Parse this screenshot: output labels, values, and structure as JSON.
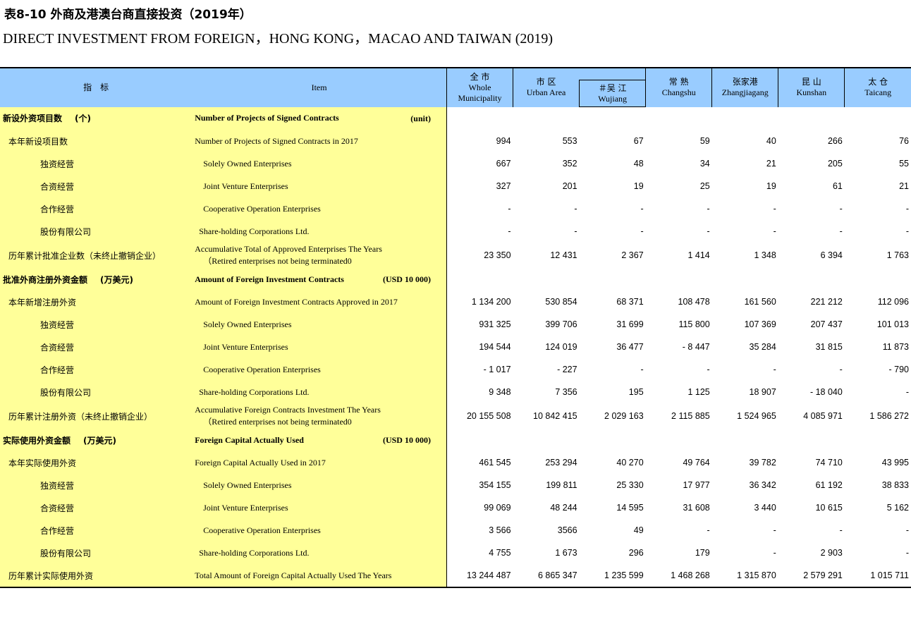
{
  "title": {
    "cn": "表8-10 外商及港澳台商直接投资（2019年）",
    "en": "DIRECT INVESTMENT FROM FOREIGN，HONG KONG，MACAO AND TAIWAN (2019)"
  },
  "header": {
    "indicator": "指　标",
    "item": "Item",
    "whole": {
      "cn": "全 市",
      "en1": "Whole",
      "en2": "Municipality"
    },
    "urban": {
      "cn": "市 区",
      "en": "Urban Area"
    },
    "wujiang": {
      "cn": "＃吴 江",
      "en": "Wujiang"
    },
    "changshu": {
      "cn": "常 熟",
      "en": "Changshu"
    },
    "zhangjiagang": {
      "cn": "张家港",
      "en": "Zhangjiagang"
    },
    "kunshan": {
      "cn": "昆 山",
      "en": "Kunshan"
    },
    "taicang": {
      "cn": "太 仓",
      "en": "Taicang"
    }
  },
  "sections": [
    {
      "cn": "新设外资项目数",
      "cn_unit": "(个)",
      "en": "Number of Projects of Signed Contracts",
      "en_unit": "(unit)",
      "rows": [
        {
          "cn": "本年新设项目数",
          "en": "Number of Projects of Signed Contracts in 2017",
          "v": [
            "994",
            "553",
            "67",
            "59",
            "40",
            "266",
            "76"
          ]
        },
        {
          "cn": "独资经营",
          "en": "Solely Owned Enterprises",
          "v": [
            "667",
            "352",
            "48",
            "34",
            "21",
            "205",
            "55"
          ]
        },
        {
          "cn": "合资经营",
          "en": "Joint Venture Enterprises",
          "v": [
            "327",
            "201",
            "19",
            "25",
            "19",
            "61",
            "21"
          ]
        },
        {
          "cn": "合作经营",
          "en": "Cooperative Operation Enterprises",
          "v": [
            "-",
            "-",
            "-",
            "-",
            "-",
            "-",
            "-"
          ]
        },
        {
          "cn": "股份有限公司",
          "en": "Share-holding Corporations Ltd.",
          "v": [
            "-",
            "-",
            "-",
            "-",
            "-",
            "-",
            "-"
          ]
        },
        {
          "cn": "历年累计批准企业数（未终止撤销企业）",
          "en1": "Accumulative Total of Approved Enterprises The Years",
          "en2": "（Retired enterprises not being terminated0",
          "v": [
            "23 350",
            "12 431",
            "2 367",
            "1 414",
            "1 348",
            "6 394",
            "1 763"
          ]
        }
      ]
    },
    {
      "cn": "批准外商注册外资金额",
      "cn_unit": "(万美元)",
      "en": "Amount of Foreign Investment Contracts",
      "en_unit": "(USD 10 000)",
      "rows": [
        {
          "cn": "本年新增注册外资",
          "en": "Amount of Foreign Investment Contracts Approved in 2017",
          "v": [
            "1 134 200",
            "530 854",
            "68 371",
            "108 478",
            "161 560",
            "221 212",
            "112 096"
          ]
        },
        {
          "cn": "独资经营",
          "en": "Solely Owned Enterprises",
          "v": [
            "931 325",
            "399 706",
            "31 699",
            "115 800",
            "107 369",
            "207 437",
            "101 013"
          ]
        },
        {
          "cn": "合资经营",
          "en": "Joint Venture Enterprises",
          "v": [
            "194 544",
            "124 019",
            "36 477",
            "- 8 447",
            "35 284",
            "31 815",
            "11 873"
          ]
        },
        {
          "cn": "合作经营",
          "en": "Cooperative Operation Enterprises",
          "v": [
            "- 1 017",
            "-  227",
            "-",
            "-",
            "-",
            "-",
            "-  790"
          ]
        },
        {
          "cn": "股份有限公司",
          "en": "Share-holding Corporations Ltd.",
          "v": [
            "9 348",
            "7 356",
            "195",
            "1 125",
            "18 907",
            "- 18 040",
            "-"
          ]
        },
        {
          "cn": "历年累计注册外资（未终止撤销企业）",
          "en1": "Accumulative Foreign Contracts Investment The Years",
          "en2": "（Retired enterprises not being terminated0",
          "v": [
            "20 155 508",
            "10 842 415",
            "2 029 163",
            "2 115 885",
            "1 524 965",
            "4 085 971",
            "1 586 272"
          ]
        }
      ]
    },
    {
      "cn": "实际使用外资金额",
      "cn_unit": "(万美元)",
      "en": "Foreign Capital Actually Used",
      "en_unit": "(USD 10 000)",
      "rows": [
        {
          "cn": "本年实际使用外资",
          "en": "Foreign Capital Actually Used in 2017",
          "v": [
            "461 545",
            "253 294",
            "40 270",
            "49 764",
            "39 782",
            "74 710",
            "43 995"
          ]
        },
        {
          "cn": "独资经营",
          "en": "Solely Owned Enterprises",
          "v": [
            "354 155",
            "199 811",
            "25 330",
            "17 977",
            "36 342",
            "61 192",
            "38 833"
          ]
        },
        {
          "cn": "合资经营",
          "en": "Joint Venture Enterprises",
          "v": [
            "99 069",
            "48 244",
            "14 595",
            "31 608",
            "3 440",
            "10 615",
            "5 162"
          ]
        },
        {
          "cn": "合作经营",
          "en": "Cooperative Operation Enterprises",
          "v": [
            "3 566",
            "3566",
            "49",
            "-",
            "-",
            "-",
            "-"
          ]
        },
        {
          "cn": "股份有限公司",
          "en": "Share-holding Corporations Ltd.",
          "v": [
            "4 755",
            "1 673",
            "296",
            "179",
            "-",
            "2 903",
            "-"
          ]
        },
        {
          "cn": "历年累计实际使用外资",
          "en": "Total Amount of Foreign Capital Actually Used The Years",
          "v": [
            "13 244 487",
            "6 865 347",
            "1 235 599",
            "1 468 268",
            "1 315 870",
            "2 579 291",
            "1 015 711"
          ]
        }
      ]
    }
  ]
}
